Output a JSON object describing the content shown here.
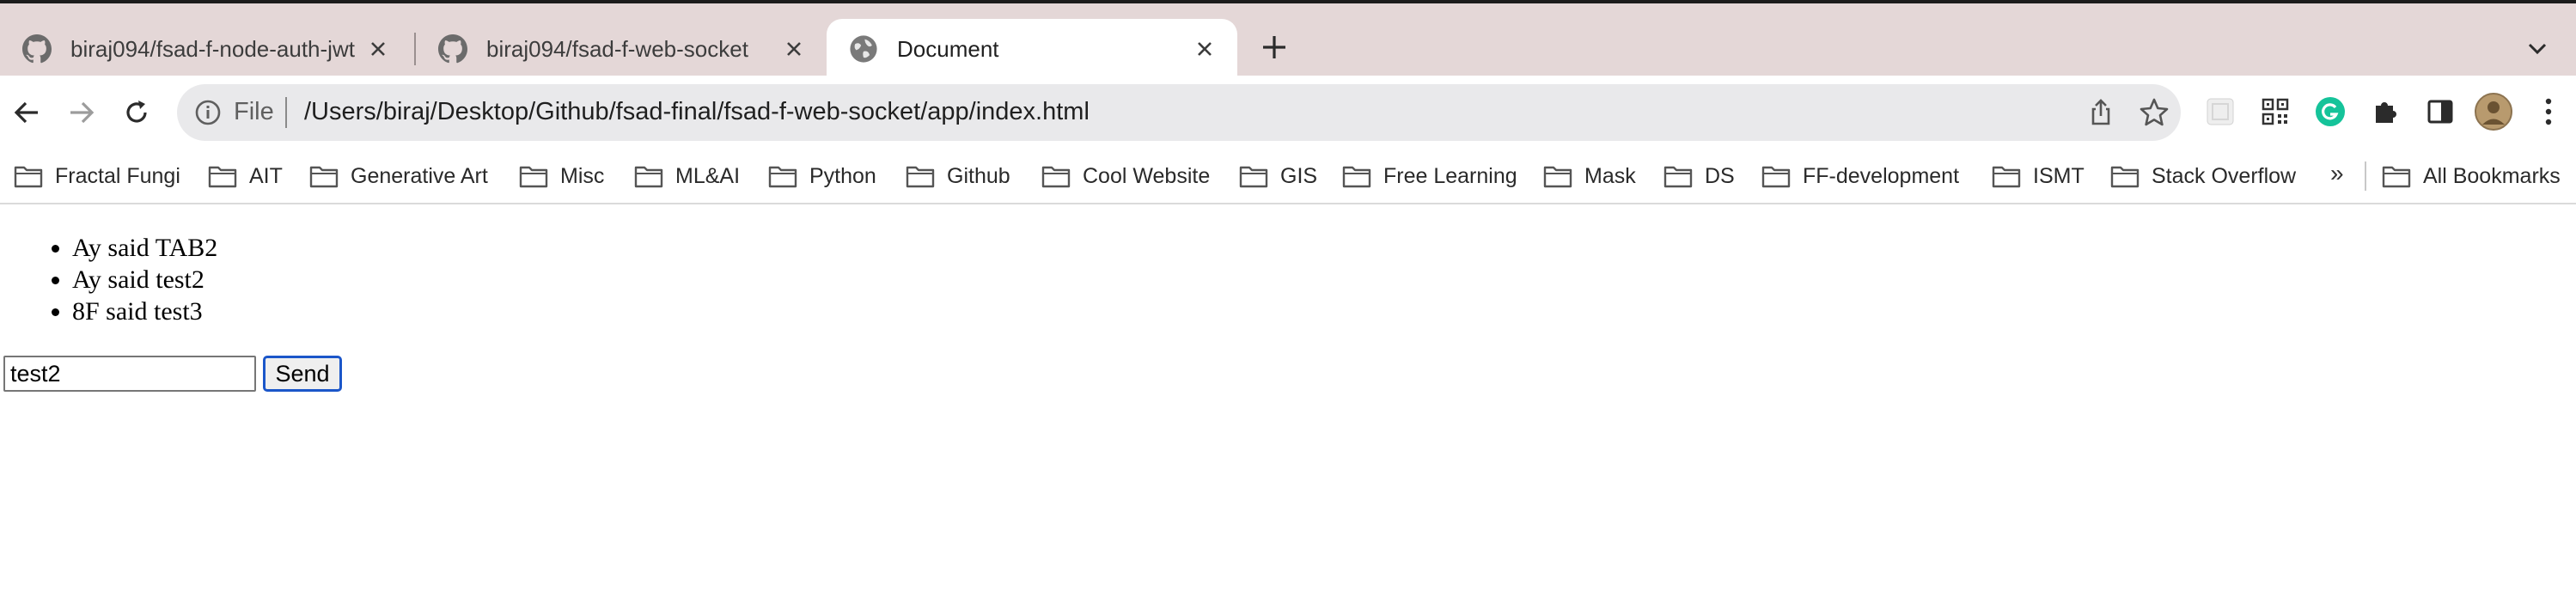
{
  "tabs": [
    {
      "title": "biraj094/fsad-f-node-auth-jwt",
      "favicon": "github-icon",
      "active": false
    },
    {
      "title": "biraj094/fsad-f-web-socket",
      "favicon": "github-icon",
      "active": false
    },
    {
      "title": "Document",
      "favicon": "globe-icon",
      "active": true
    }
  ],
  "toolbar": {
    "scheme": "File",
    "url": "/Users/biraj/Desktop/Github/fsad-final/fsad-f-web-socket/app/index.html"
  },
  "bookmarks": {
    "items": [
      "Fractal Fungi",
      "AIT",
      "Generative Art",
      "Misc",
      "ML&AI",
      "Python",
      "Github",
      "Cool Website",
      "GIS",
      "Free Learning",
      "Mask",
      "DS",
      "FF-development",
      "ISMT",
      "Stack Overflow"
    ],
    "more": "»",
    "all_bookmarks": "All Bookmarks"
  },
  "page": {
    "messages": [
      "Ay said TAB2",
      "Ay said test2",
      "8F said test3"
    ],
    "input_value": "test2",
    "send_label": "Send"
  },
  "colors": {
    "tabstrip_bg": "#e4d7d7",
    "omnibox_bg": "#e9e9eb",
    "focus_ring": "#1b56c9",
    "grammarly_green": "#15c39a"
  }
}
